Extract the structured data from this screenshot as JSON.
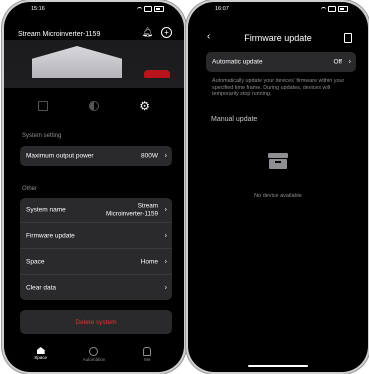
{
  "left": {
    "status_time": "15:16",
    "header_title": "Stream Microinverter-1159",
    "section_system": "System setting",
    "max_output": {
      "label": "Maximum output power",
      "value": "800W"
    },
    "section_other": "Other",
    "system_name": {
      "label": "System name",
      "value_line1": "Stream",
      "value_line2": "Microinverter-1159"
    },
    "firmware_update": {
      "label": "Firmware update"
    },
    "space": {
      "label": "Space",
      "value": "Home"
    },
    "clear_data": {
      "label": "Clear data"
    },
    "delete_label": "Delete system",
    "tabbar": {
      "space": "Space",
      "automation": "Automation",
      "me": "Me"
    }
  },
  "right": {
    "status_time": "16:07",
    "title": "Firmware update",
    "automatic": {
      "label": "Automatic update",
      "value": "Off"
    },
    "description": "Automatically update your devices' firmware within your specified time frame. During updates, devices will temporarily stop running.",
    "manual_label": "Manual update",
    "empty_text": "No device available"
  },
  "icons": {
    "back": "chevron-left-icon",
    "chevron": "chevron-right-icon"
  },
  "colors": {
    "background": "#000000",
    "card": "#2a2a2c",
    "danger": "#e6332f",
    "muted": "#8e8e93"
  }
}
